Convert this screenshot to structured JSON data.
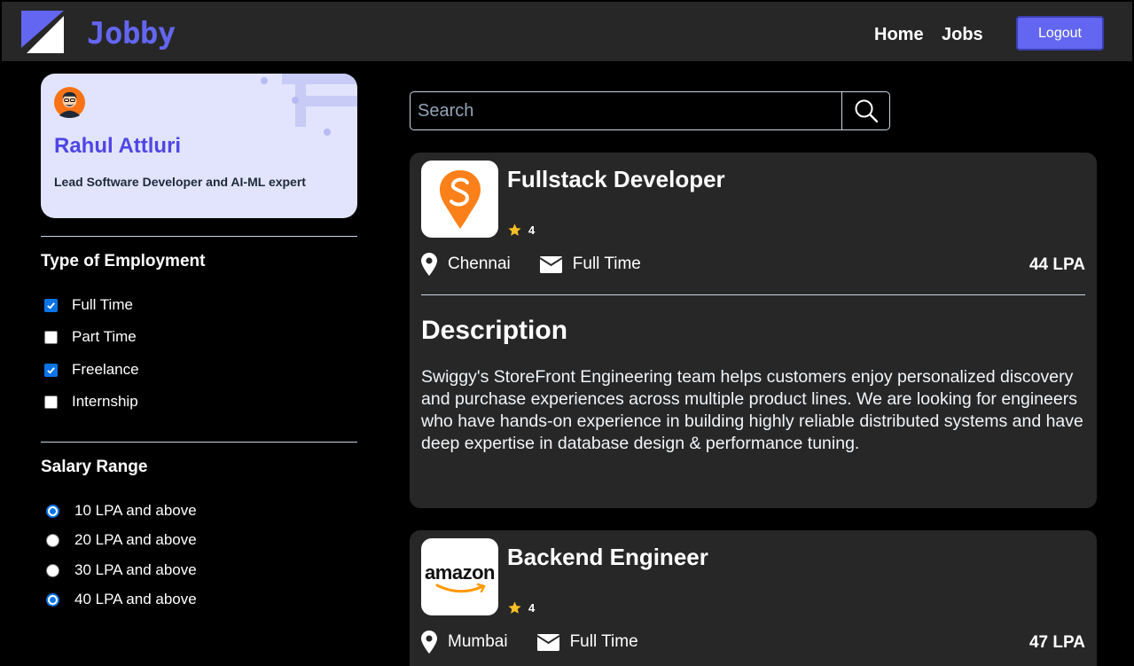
{
  "header": {
    "brand": "Jobby",
    "nav": {
      "home": "Home",
      "jobs": "Jobs"
    },
    "logout_label": "Logout",
    "accent_color": "#6366f1"
  },
  "profile": {
    "name": "Rahul Attluri",
    "bio": "Lead Software Developer and AI-ML expert",
    "card_color": "#e2e4fd"
  },
  "filters": {
    "employment": {
      "heading": "Type of Employment",
      "options": [
        {
          "label": "Full Time",
          "checked": true
        },
        {
          "label": "Part Time",
          "checked": false
        },
        {
          "label": "Freelance",
          "checked": true
        },
        {
          "label": "Internship",
          "checked": false
        }
      ]
    },
    "salary": {
      "heading": "Salary Range",
      "options": [
        {
          "label": "10 LPA and above",
          "selected": true
        },
        {
          "label": "20 LPA and above",
          "selected": false
        },
        {
          "label": "30 LPA and above",
          "selected": false
        },
        {
          "label": "40 LPA and above",
          "selected": true
        }
      ]
    }
  },
  "search": {
    "placeholder": "Search",
    "value": ""
  },
  "jobs": [
    {
      "company": "swiggy",
      "title": "Fullstack Developer",
      "rating": "4",
      "location": "Chennai",
      "employment_type": "Full Time",
      "package": "44 LPA",
      "description_heading": "Description",
      "description": "Swiggy's StoreFront Engineering team helps customers enjoy personalized discovery and purchase experiences across multiple product lines. We are looking for engineers who have hands-on experience in building highly reliable distributed systems and have deep expertise in database design & performance tuning."
    },
    {
      "company": "amazon",
      "logo_text": "amazon",
      "title": "Backend Engineer",
      "rating": "4",
      "location": "Mumbai",
      "employment_type": "Full Time",
      "package": "47 LPA"
    }
  ]
}
